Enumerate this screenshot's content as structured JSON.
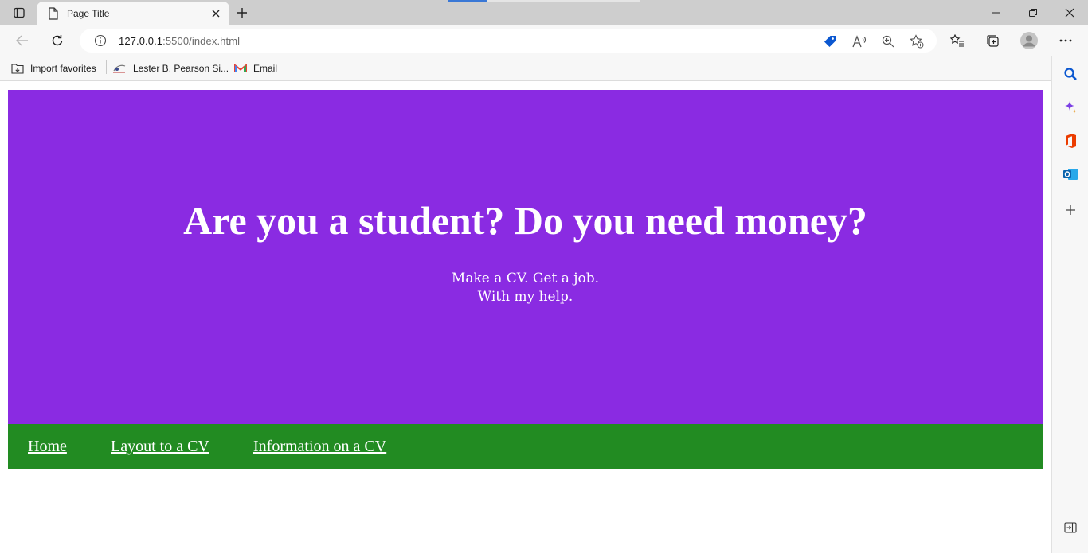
{
  "browser": {
    "tab_title": "Page Title",
    "url_host": "127.0.0.1",
    "url_rest": ":5500/index.html",
    "favorites": [
      {
        "label": "Import favorites",
        "icon": "import-icon"
      },
      {
        "label": "Lester B. Pearson Si...",
        "icon": "school-icon"
      },
      {
        "label": "Email",
        "icon": "gmail-icon"
      }
    ],
    "sidebar_icons": [
      "search-icon",
      "copilot-icon",
      "office-icon",
      "outlook-icon",
      "add-icon"
    ],
    "accent": "#0b57d0"
  },
  "page": {
    "hero_title": "Are you a student? Do you need money?",
    "hero_line1": "Make a CV. Get a job.",
    "hero_line2": "With my help.",
    "hero_color": "#8a2be2",
    "nav_color": "#228b22",
    "nav_links": [
      "Home",
      "Layout to a CV",
      "Information on a CV"
    ]
  }
}
